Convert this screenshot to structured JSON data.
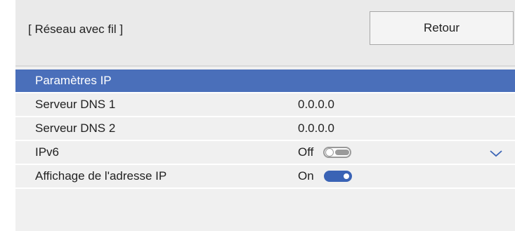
{
  "header": {
    "title": "[ Réseau avec fil ]",
    "back_label": "Retour"
  },
  "rows": [
    {
      "label": "Paramètres IP",
      "value": ""
    },
    {
      "label": "Serveur DNS 1",
      "value": "0.0.0.0"
    },
    {
      "label": "Serveur DNS 2",
      "value": "0.0.0.0"
    },
    {
      "label": "IPv6",
      "value": "Off",
      "toggle": "off"
    },
    {
      "label": "Affichage de l'adresse IP",
      "value": "On",
      "toggle": "on"
    }
  ],
  "icons": {
    "scroll_down": "chevron-down-icon"
  },
  "colors": {
    "selected": "#4a6fba",
    "toggle_on": "#3a63b5"
  }
}
